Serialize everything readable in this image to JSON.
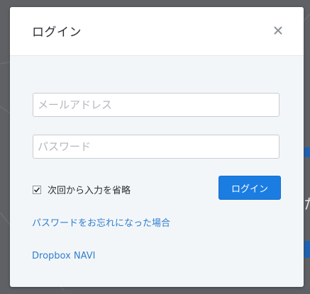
{
  "dialog": {
    "title": "ログイン",
    "close_label": "close"
  },
  "form": {
    "email_placeholder": "メールアドレス",
    "email_value": "",
    "password_placeholder": "パスワード",
    "password_value": "",
    "remember_label": "次回から入力を省略",
    "remember_checked": true,
    "submit_label": "ログイン"
  },
  "links": {
    "forgot_password": "パスワードをお忘れになった場合",
    "dropbox_navi": "Dropbox NAVI"
  },
  "background": {
    "peek_text": "た"
  },
  "colors": {
    "primary_button": "#1b7de2",
    "link": "#2f7fcf",
    "overlay": "#5f6164",
    "modal_body": "#f3f6f9"
  },
  "icons": {
    "close": "close-icon",
    "check": "check-icon"
  }
}
